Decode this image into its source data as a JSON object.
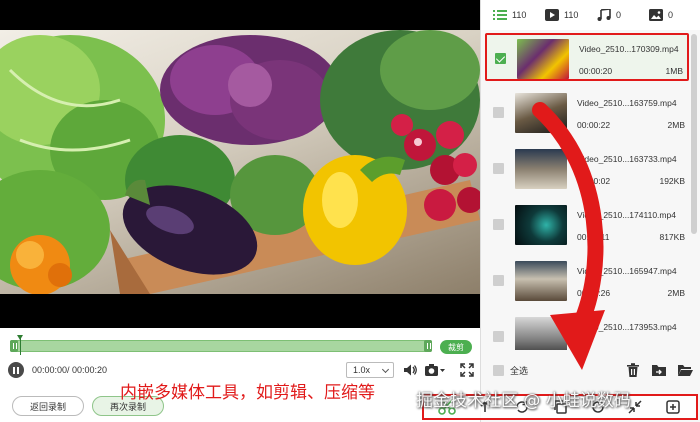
{
  "filters": [
    {
      "icon": "list-icon",
      "count": "110"
    },
    {
      "icon": "video-icon",
      "count": "110"
    },
    {
      "icon": "music-icon",
      "count": "0"
    },
    {
      "icon": "image-icon",
      "count": "0"
    }
  ],
  "files": [
    {
      "name": "Video_2510...170309.mp4",
      "duration": "00:00:20",
      "size": "1MB",
      "selected": true
    },
    {
      "name": "Video_2510...163759.mp4",
      "duration": "00:00:22",
      "size": "2MB",
      "selected": false
    },
    {
      "name": "Video_2510...163733.mp4",
      "duration": "00:00:02",
      "size": "192KB",
      "selected": false
    },
    {
      "name": "Video_2510...174110.mp4",
      "duration": "00:00:11",
      "size": "817KB",
      "selected": false
    },
    {
      "name": "Video_2510...165947.mp4",
      "duration": "00:00:26",
      "size": "2MB",
      "selected": false
    },
    {
      "name": "Video_2510...173953.mp4",
      "duration": "",
      "size": "",
      "selected": false
    }
  ],
  "player": {
    "time": "00:00:00/ 00:00:20",
    "speed": "1.0x",
    "trim_label": "裁剪"
  },
  "buttons": {
    "back": "返回录制",
    "again": "再次录制"
  },
  "panel": {
    "select_all": "全选"
  },
  "overlay": {
    "caption": "内嵌多媒体工具，如剪辑、压缩等",
    "watermark": "掘金技术社区 @ 小蛙说数码"
  },
  "colors": {
    "accent": "#4caf50",
    "highlight": "#e11a1a"
  }
}
